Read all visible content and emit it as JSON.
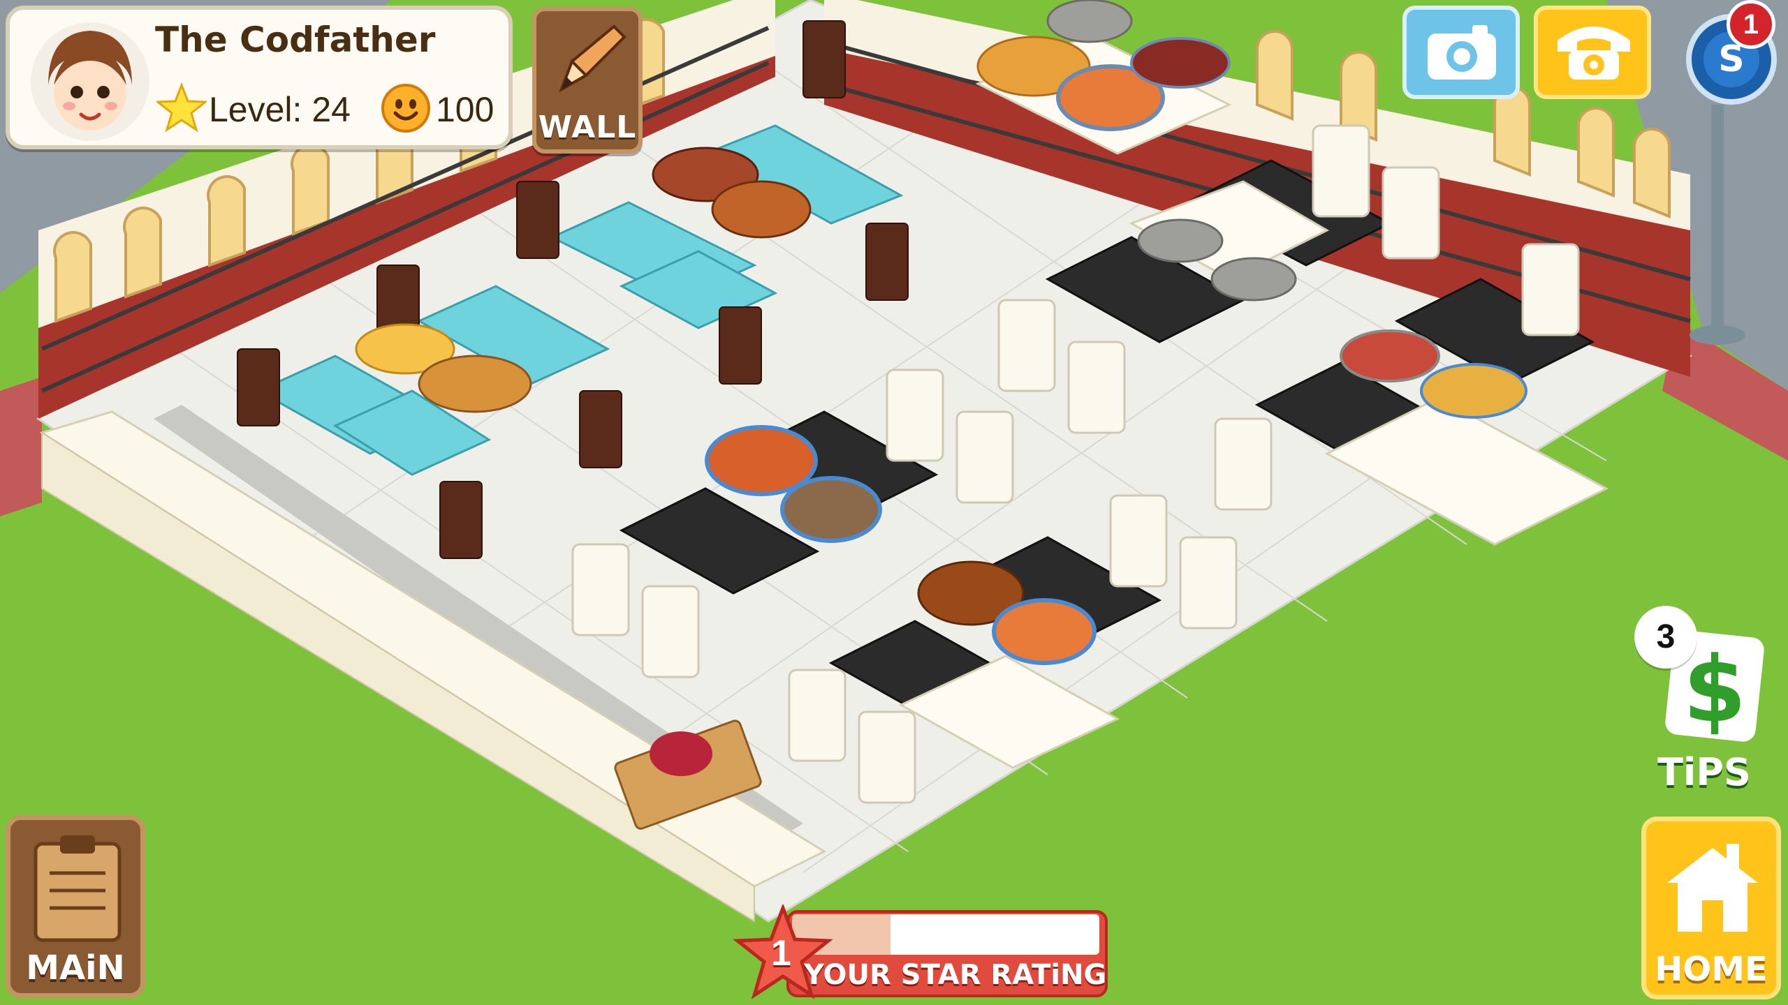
{
  "player": {
    "name": "The Codfather",
    "level_label": "Level: 24",
    "coins": "100"
  },
  "buttons": {
    "wall": "WALL",
    "main": "MAiN",
    "home": "HOME",
    "tips": "TiPS"
  },
  "tips": {
    "count": "3"
  },
  "notifications": {
    "social_badge": "1"
  },
  "star_rating": {
    "level": "1",
    "label": "YOUR STAR RATiNG",
    "progress_fraction": 0.32
  },
  "colors": {
    "lawn": "#7ec13b",
    "floor": "#f1f1ec",
    "brick": "#a8352b",
    "wall_panel": "#f7f2e2",
    "table_black": "#2b2b2b",
    "table_teal": "#6fd3de",
    "hud_yellow": "#ffc31a",
    "hud_brown": "#8a5a32",
    "hud_blue": "#6ec3e8",
    "rating_red": "#e14b3d"
  },
  "icons": {
    "avatar": "chef-girl-avatar",
    "level": "star-icon",
    "coins": "coin-smiley-icon",
    "wall": "pencil-icon",
    "camera": "camera-icon",
    "phone": "phone-icon",
    "social": "social-s-icon",
    "tips": "dollar-icon",
    "main": "clipboard-icon",
    "home": "house-icon"
  }
}
